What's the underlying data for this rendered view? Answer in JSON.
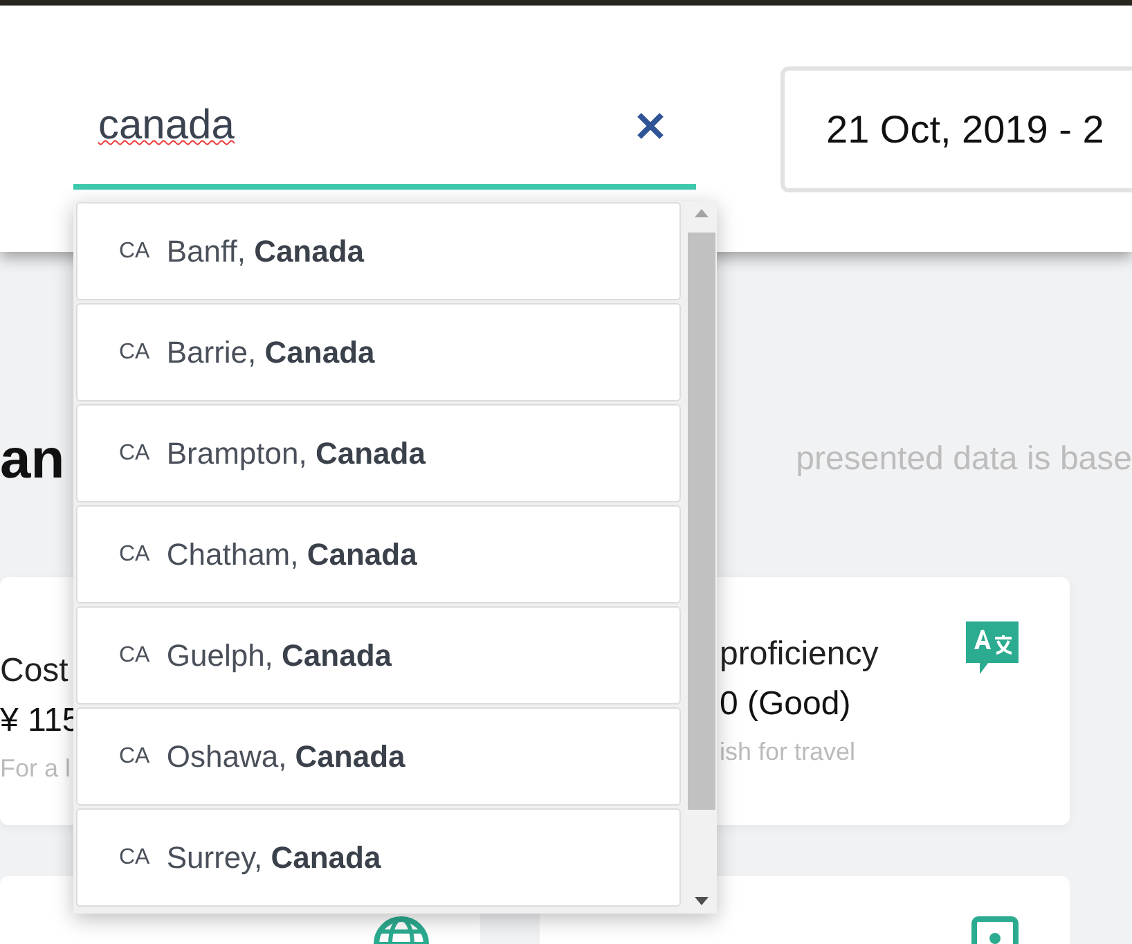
{
  "search": {
    "value": "canada"
  },
  "date_range": {
    "value": "21 Oct, 2019 - 2"
  },
  "suggestions": [
    {
      "code": "CA",
      "label": "Banff, **Canada**"
    },
    {
      "code": "CA",
      "label": "Barrie, **Canada**"
    },
    {
      "code": "CA",
      "label": "Brampton, **Canada**"
    },
    {
      "code": "CA",
      "label": "Chatham, **Canada**"
    },
    {
      "code": "CA",
      "label": "Guelph, **Canada**"
    },
    {
      "code": "CA",
      "label": "Oshawa, **Canada**"
    },
    {
      "code": "CA",
      "label": "Surrey, **Canada**"
    }
  ],
  "heading": "an",
  "note": "presented data is base",
  "cards": [
    {
      "kind": "cost",
      "label": "Cost",
      "value": "¥ 115",
      "note": "For a l"
    },
    {
      "kind": "language",
      "label": "proficiency",
      "value": "0 (Good)",
      "note": "ish for travel"
    }
  ],
  "lower_cards": [
    {
      "kind": "globe"
    },
    {
      "kind": "phone"
    }
  ]
}
